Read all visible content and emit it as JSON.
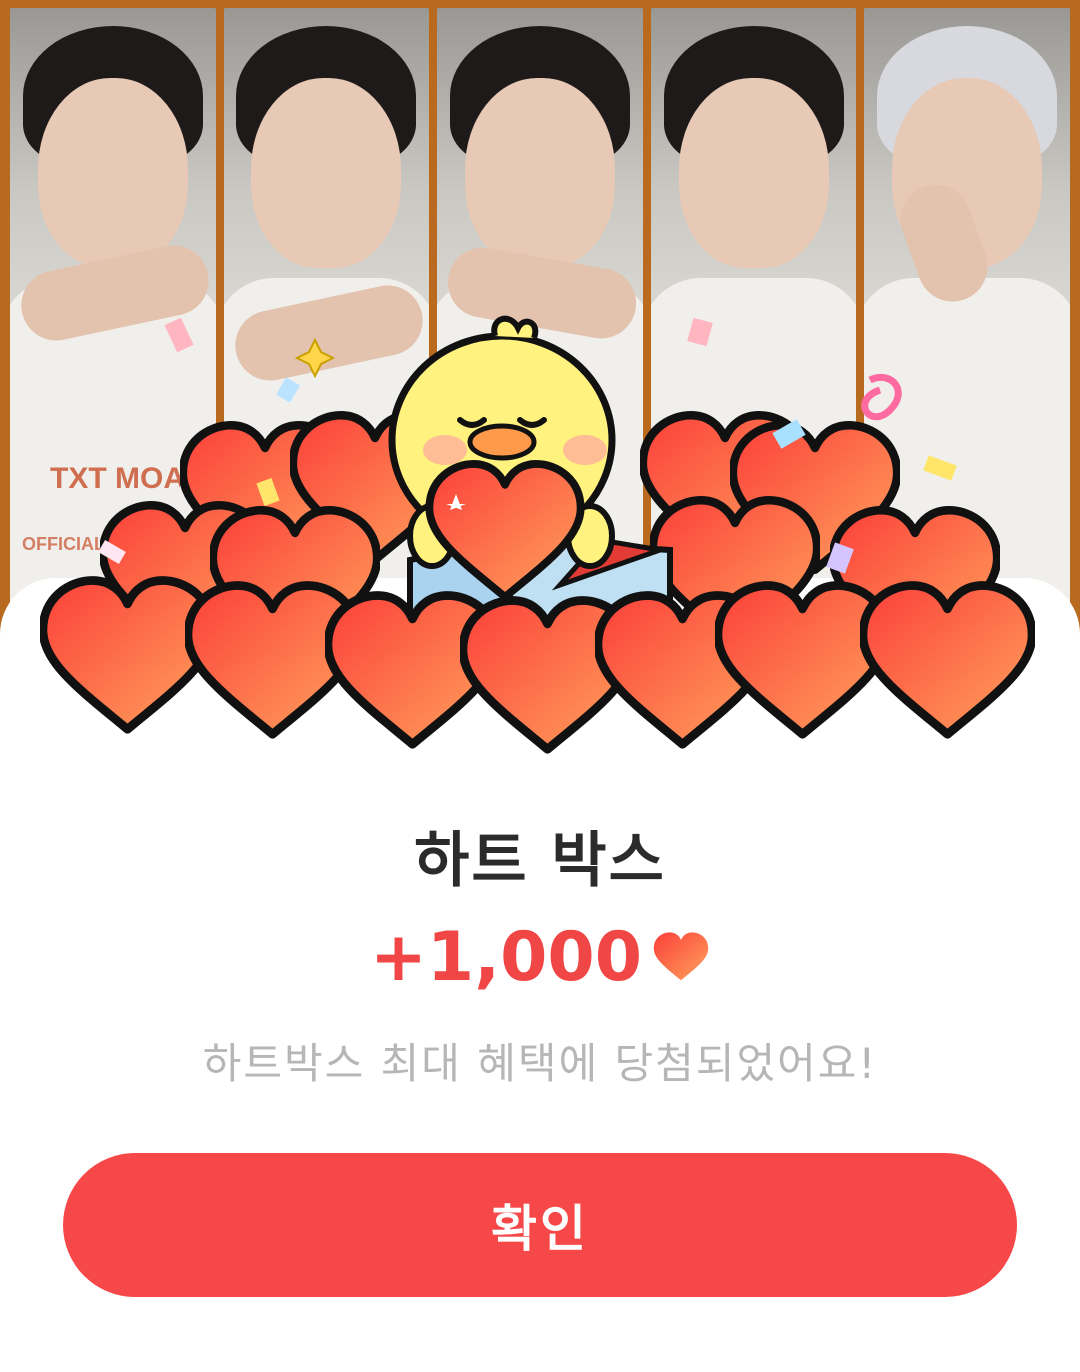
{
  "popup": {
    "title": "하트 박스",
    "amount": "+1,000",
    "amount_icon": "heart-icon",
    "message": "하트박스 최대 혜택에 당첨되었어요!",
    "confirm_label": "확인"
  },
  "background": {
    "logo_text": "TXT MOA CON",
    "watermark_text": "OFFICIAL"
  },
  "colors": {
    "accent": "#f64848",
    "amount": "#f04646",
    "title": "#2b2b2b",
    "message": "#b6b6b6",
    "frame": "#b86a1e"
  }
}
